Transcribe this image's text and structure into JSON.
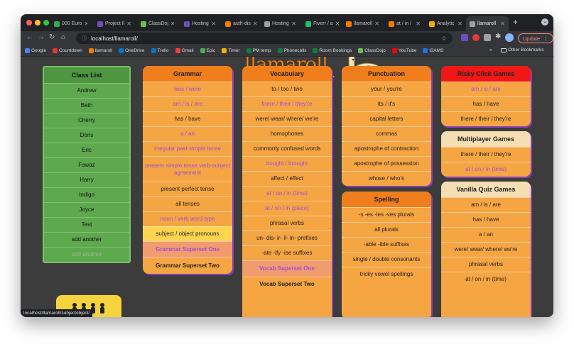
{
  "tabs": [
    {
      "label": "000 Euro",
      "active": false,
      "color": "#34a853"
    },
    {
      "label": "Project Il",
      "active": false,
      "color": "#6b4fbb"
    },
    {
      "label": "ClassDoj",
      "active": false,
      "color": "#6ac04f"
    },
    {
      "label": "Hosting",
      "active": false,
      "color": "#6b4fbb"
    },
    {
      "label": "auth-dis",
      "active": false,
      "color": "#f57c00"
    },
    {
      "label": "Hosting",
      "active": false,
      "color": "#9aa0a6"
    },
    {
      "label": "Fiverr / a",
      "active": false,
      "color": "#1dbf73"
    },
    {
      "label": "llamaroll",
      "active": false,
      "color": "#f57c00"
    },
    {
      "label": "at / in /",
      "active": false,
      "color": "#f57c00"
    },
    {
      "label": "Analytic",
      "active": false,
      "color": "#f9ab00"
    },
    {
      "label": "llamaroll",
      "active": true,
      "color": "#9aa0a6"
    }
  ],
  "url": "localhost/llamaroll/",
  "update_label": "Update",
  "bookmarks": [
    {
      "label": "Google",
      "color": "#4285f4"
    },
    {
      "label": "Countdown",
      "color": "#e53935"
    },
    {
      "label": "llamaroll",
      "color": "#f57c00"
    },
    {
      "label": "OneDrive",
      "color": "#0078d4"
    },
    {
      "label": "Trello",
      "color": "#0079bf"
    },
    {
      "label": "Gmail",
      "color": "#ea4335"
    },
    {
      "label": "Epic",
      "color": "#4caf50"
    },
    {
      "label": "Timer",
      "color": "#f4b400"
    },
    {
      "label": "PM temp",
      "color": "#0b8043"
    },
    {
      "label": "Phonecalls",
      "color": "#0b8043"
    },
    {
      "label": "Room Bookings",
      "color": "#0b8043"
    },
    {
      "label": "ClassDojo",
      "color": "#6ac04f"
    },
    {
      "label": "YouTube",
      "color": "#ff0000"
    },
    {
      "label": "iSAMS",
      "color": "#1a73e8"
    }
  ],
  "bookmarks_more": "»",
  "other_bookmarks": "Other Bookmarks",
  "class_list": {
    "title": "Class List",
    "items": [
      "Andrew",
      "Beth",
      "Cherry",
      "Doris",
      "Eric",
      "Fawaz",
      "Harry",
      "Indigo",
      "Joyce",
      "Test",
      "add another",
      "add another"
    ]
  },
  "grammar": {
    "title": "Grammar",
    "items": [
      {
        "label": "was / were",
        "purple": true
      },
      {
        "label": "am / is / are",
        "purple": true
      },
      {
        "label": "has / have",
        "purple": false
      },
      {
        "label": "a / an",
        "purple": true
      },
      {
        "label": "irregular past simple tense",
        "purple": true
      },
      {
        "label": "present simple tense verb-subject agreement",
        "purple": true
      },
      {
        "label": "present perfect tense",
        "purple": false
      },
      {
        "label": "all tenses",
        "purple": false
      },
      {
        "label": "noun / verb word type",
        "purple": true
      },
      {
        "label": "subject / object pronouns",
        "purple": false
      },
      {
        "label": "Grammar Superset One",
        "purple": true
      },
      {
        "label": "Grammar Superset Two",
        "purple": false
      }
    ]
  },
  "vocabulary": {
    "title": "Vocabulary",
    "items": [
      {
        "label": "to / too / two",
        "purple": false
      },
      {
        "label": "there / their / they're",
        "purple": true
      },
      {
        "label": "were/ wear/ where/ we're",
        "purple": false
      },
      {
        "label": "homophones",
        "purple": false
      },
      {
        "label": "commonly confused words",
        "purple": false
      },
      {
        "label": "bought / brought",
        "purple": true
      },
      {
        "label": "affect / effect",
        "purple": false
      },
      {
        "label": "at / on / in (time)",
        "purple": true
      },
      {
        "label": "at / on / in (place)",
        "purple": true
      },
      {
        "label": "phrasal verbs",
        "purple": false
      },
      {
        "label": "un- dis- ir- il- in- prefixes",
        "purple": false
      },
      {
        "label": "-ate -ify -ise suffixes",
        "purple": false
      },
      {
        "label": "Vocab Superset One",
        "purple": true
      },
      {
        "label": "Vocab Superset Two",
        "purple": false
      }
    ]
  },
  "punctuation": {
    "title": "Punctuation",
    "items": [
      "your / you're",
      "its / it's",
      "capital letters",
      "commas",
      "apostrophe of contraction",
      "apostrophe of possession",
      "whose / who's"
    ]
  },
  "spelling": {
    "title": "Spelling",
    "items": [
      "-s -es -ies -ves plurals",
      "all plurals",
      "-able -ible suffixes",
      "single / double consonants",
      "tricky vowel spellings"
    ]
  },
  "risky": {
    "title": "Risky Click Games",
    "items": [
      {
        "label": "am / is / are",
        "purple": true
      },
      {
        "label": "has / have",
        "purple": false
      },
      {
        "label": "there / their / they're",
        "purple": false
      }
    ]
  },
  "multiplayer": {
    "title": "Multiplayer Games",
    "items": [
      {
        "label": "there / their / they're",
        "purple": false
      },
      {
        "label": "at / on / in (time)",
        "purple": true
      }
    ]
  },
  "vanilla": {
    "title": "Vanilla Quiz Games",
    "items": [
      "am / is / are",
      "has / have",
      "a / an",
      "were/ wear/ where/ we're",
      "phrasal verbs",
      "at / on / in (time)"
    ]
  },
  "logo_text": "llamaroll",
  "status_url": "localhost/llamaroll/subjectobject/",
  "colors": {
    "orange": "#f5a542",
    "orange_head": "#f07e1c",
    "green": "#5ea94e",
    "green_head": "#4e9640",
    "red": "#f01717",
    "cream": "#f5deb3",
    "purple": "#a04fe0",
    "highlight": "#ffd54f",
    "superset": "#f29b6c"
  }
}
